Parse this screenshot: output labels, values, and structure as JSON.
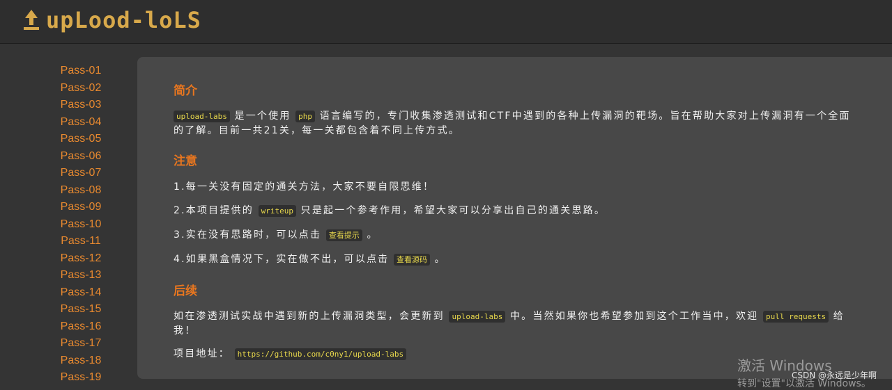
{
  "header": {
    "logo_text": "upLood-loLS"
  },
  "sidebar": {
    "items": [
      {
        "label": "Pass-01"
      },
      {
        "label": "Pass-02"
      },
      {
        "label": "Pass-03"
      },
      {
        "label": "Pass-04"
      },
      {
        "label": "Pass-05"
      },
      {
        "label": "Pass-06"
      },
      {
        "label": "Pass-07"
      },
      {
        "label": "Pass-08"
      },
      {
        "label": "Pass-09"
      },
      {
        "label": "Pass-10"
      },
      {
        "label": "Pass-11"
      },
      {
        "label": "Pass-12"
      },
      {
        "label": "Pass-13"
      },
      {
        "label": "Pass-14"
      },
      {
        "label": "Pass-15"
      },
      {
        "label": "Pass-16"
      },
      {
        "label": "Pass-17"
      },
      {
        "label": "Pass-18"
      },
      {
        "label": "Pass-19"
      }
    ]
  },
  "intro": {
    "heading": "简介",
    "code1": "upload-labs",
    "text1": "是一个使用",
    "code2": "php",
    "text2": "语言编写的，专门收集渗透测试和CTF中遇到的各种上传漏洞的靶场。旨在帮助大家对上传漏洞有一个全面的了解。目前一共21关，每一关都包含着不同上传方式。"
  },
  "notes": {
    "heading": "注意",
    "item1": "1.每一关没有固定的通关方法，大家不要自限思维！",
    "item2_pre": "2.本项目提供的",
    "item2_code": "writeup",
    "item2_post": "只是起一个参考作用，希望大家可以分享出自己的通关思路。",
    "item3_pre": "3.实在没有思路时，可以点击",
    "item3_btn": "查看提示",
    "item3_post": "。",
    "item4_pre": "4.如果黑盒情况下，实在做不出，可以点击",
    "item4_btn": "查看源码",
    "item4_post": "。"
  },
  "followup": {
    "heading": "后续",
    "text1": "如在渗透测试实战中遇到新的上传漏洞类型，会更新到",
    "code1": "upload-labs",
    "text2": "中。当然如果你也希望参加到这个工作当中，欢迎",
    "code2": "pull requests",
    "text3": "给我！",
    "address_label": "项目地址：",
    "address_url": "https://github.com/c0ny1/upload-labs"
  },
  "overlay": {
    "activate_title": "激活 Windows",
    "activate_sub": "转到\"设置\"以激活 Windows。",
    "csdn": "CSDN @永远是少年啊"
  }
}
